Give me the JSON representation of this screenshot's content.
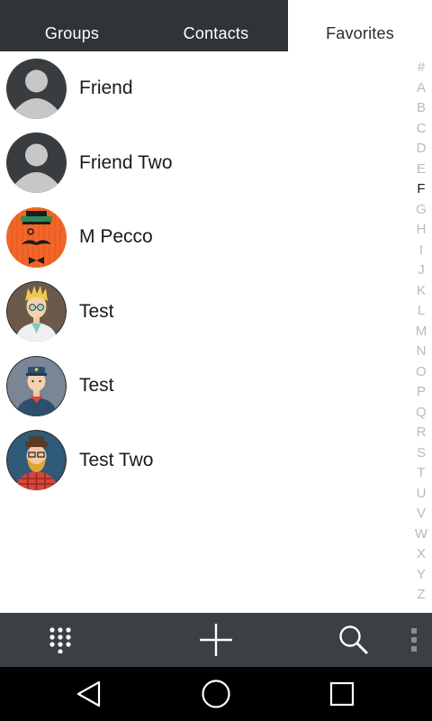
{
  "tabs": [
    {
      "label": "Groups",
      "selected": false
    },
    {
      "label": "Contacts",
      "selected": false
    },
    {
      "label": "Favorites",
      "selected": true
    }
  ],
  "contacts": [
    {
      "name": "Friend",
      "avatar": "default-person-avatar"
    },
    {
      "name": "Friend Two",
      "avatar": "default-person-avatar"
    },
    {
      "name": "M Pecco",
      "avatar": "mustache-top-hat-avatar"
    },
    {
      "name": "Test",
      "avatar": "blond-glasses-avatar"
    },
    {
      "name": "Test",
      "avatar": "cap-neckerchief-avatar"
    },
    {
      "name": "Test Two",
      "avatar": "bearded-glasses-avatar"
    }
  ],
  "alphabet_index": {
    "letters": [
      "#",
      "A",
      "B",
      "C",
      "D",
      "E",
      "F",
      "G",
      "H",
      "I",
      "J",
      "K",
      "L",
      "M",
      "N",
      "O",
      "P",
      "Q",
      "R",
      "S",
      "T",
      "U",
      "V",
      "W",
      "X",
      "Y",
      "Z"
    ],
    "active": "F"
  },
  "toolbar": {
    "buttons": [
      "dialpad-icon",
      "add-icon",
      "search-icon",
      "overflow-menu-icon"
    ]
  },
  "navbar": {
    "buttons": [
      "back-icon",
      "home-icon",
      "recents-icon"
    ]
  },
  "colors": {
    "tabbar_bg": "#2f3436",
    "toolbar_bg": "#3b4043",
    "navbar_bg": "#000000",
    "index_inactive": "#b9b9b9",
    "index_active": "#1a1a1a"
  }
}
